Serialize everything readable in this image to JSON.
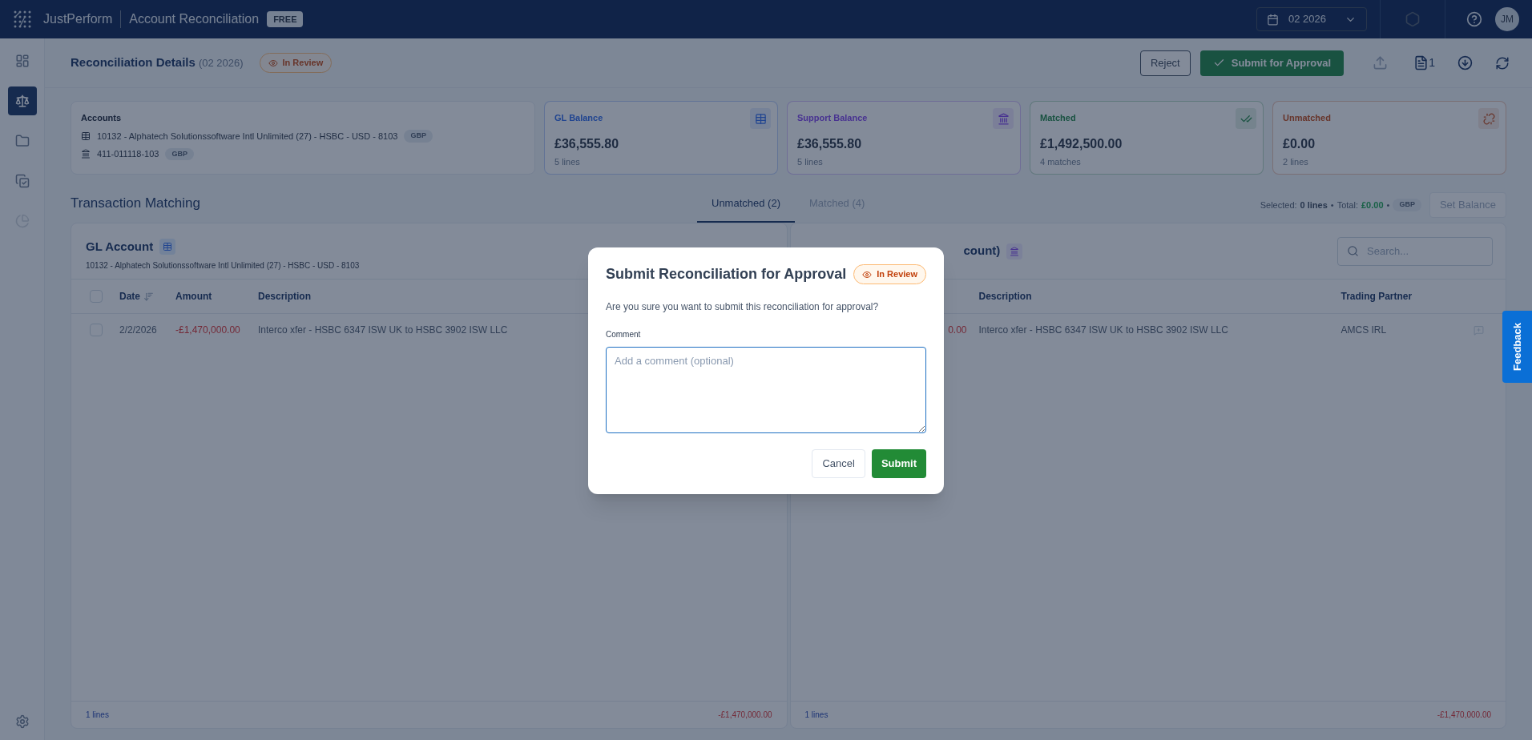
{
  "topbar": {
    "brand": "JustPerform",
    "app": "Account Reconciliation",
    "plan": "FREE",
    "period": "02 2026",
    "avatar": "JM"
  },
  "sidebar": {
    "items": [
      {
        "kind": "dashboard",
        "selected": false,
        "disabled": false
      },
      {
        "kind": "scale",
        "selected": true,
        "disabled": false
      },
      {
        "kind": "folder",
        "selected": false,
        "disabled": false
      },
      {
        "kind": "copy",
        "selected": false,
        "disabled": false
      },
      {
        "kind": "chart",
        "selected": false,
        "disabled": true
      }
    ]
  },
  "header": {
    "title": "Reconciliation Details",
    "period": "(02 2026)",
    "status": "In Review",
    "reject": "Reject",
    "submit": "Submit for Approval",
    "documents": "1"
  },
  "accounts": {
    "title": "Accounts",
    "rows": [
      {
        "kind": "gl",
        "name": "10132 - Alphatech Solutionssoftware Intl Unlimited (27) - HSBC - USD - 8103",
        "currency": "GBP"
      },
      {
        "kind": "bank",
        "name": "411-011118-103",
        "currency": "GBP"
      }
    ]
  },
  "cards": [
    {
      "kind": "gl",
      "label": "GL Balance",
      "value": "£36,555.80",
      "sub": "5 lines"
    },
    {
      "kind": "bank",
      "label": "Support Balance",
      "value": "£36,555.80",
      "sub": "5 lines"
    },
    {
      "kind": "matched",
      "label": "Matched",
      "value": "£1,492,500.00",
      "sub": "4 matches"
    },
    {
      "kind": "unmatched",
      "label": "Unmatched",
      "value": "£0.00",
      "sub": "2 lines"
    }
  ],
  "matching": {
    "title": "Transaction Matching",
    "tabs": [
      {
        "label": "Unmatched (2)",
        "selected": true
      },
      {
        "label": "Matched (4)",
        "selected": false
      }
    ],
    "selection": {
      "label": "Selected:",
      "lines": "0 lines",
      "separator_1": "•",
      "total_label": "Total:",
      "total": "£0.00",
      "separator_2": "•",
      "currency": "GBP"
    },
    "set_balance": "Set Balance"
  },
  "gl_panel": {
    "title": "GL Account",
    "subtitle": "10132 - Alphatech Solutionssoftware Intl Unlimited (27) - HSBC - USD - 8103",
    "select_all_checked": false,
    "columns": [
      "Date",
      "Amount",
      "Description"
    ],
    "rows": [
      {
        "checked": false,
        "date": "2/2/2026",
        "amount": "-£1,470,000.00",
        "description": "Interco xfer - HSBC 6347 ISW UK to HSBC 3902 ISW LLC"
      }
    ],
    "footer": {
      "count": "1 lines",
      "total": "-£1,470,000.00"
    }
  },
  "support_panel": {
    "title": "count)",
    "search_placeholder": "Search...",
    "columns": [
      "Description",
      "Trading Partner"
    ],
    "rows": [
      {
        "amount": "0.00",
        "description": "Interco xfer - HSBC 6347 ISW UK to HSBC 3902 ISW LLC",
        "partner": "AMCS IRL"
      }
    ],
    "footer": {
      "count": "1 lines",
      "total": "-£1,470,000.00"
    }
  },
  "dialog": {
    "title": "Submit Reconciliation for Approval",
    "status": "In Review",
    "message": "Are you sure you want to submit this reconciliation for approval?",
    "comment_label": "Comment",
    "comment_placeholder": "Add a comment (optional)",
    "cancel": "Cancel",
    "submit": "Submit"
  },
  "feedback": "Feedback"
}
